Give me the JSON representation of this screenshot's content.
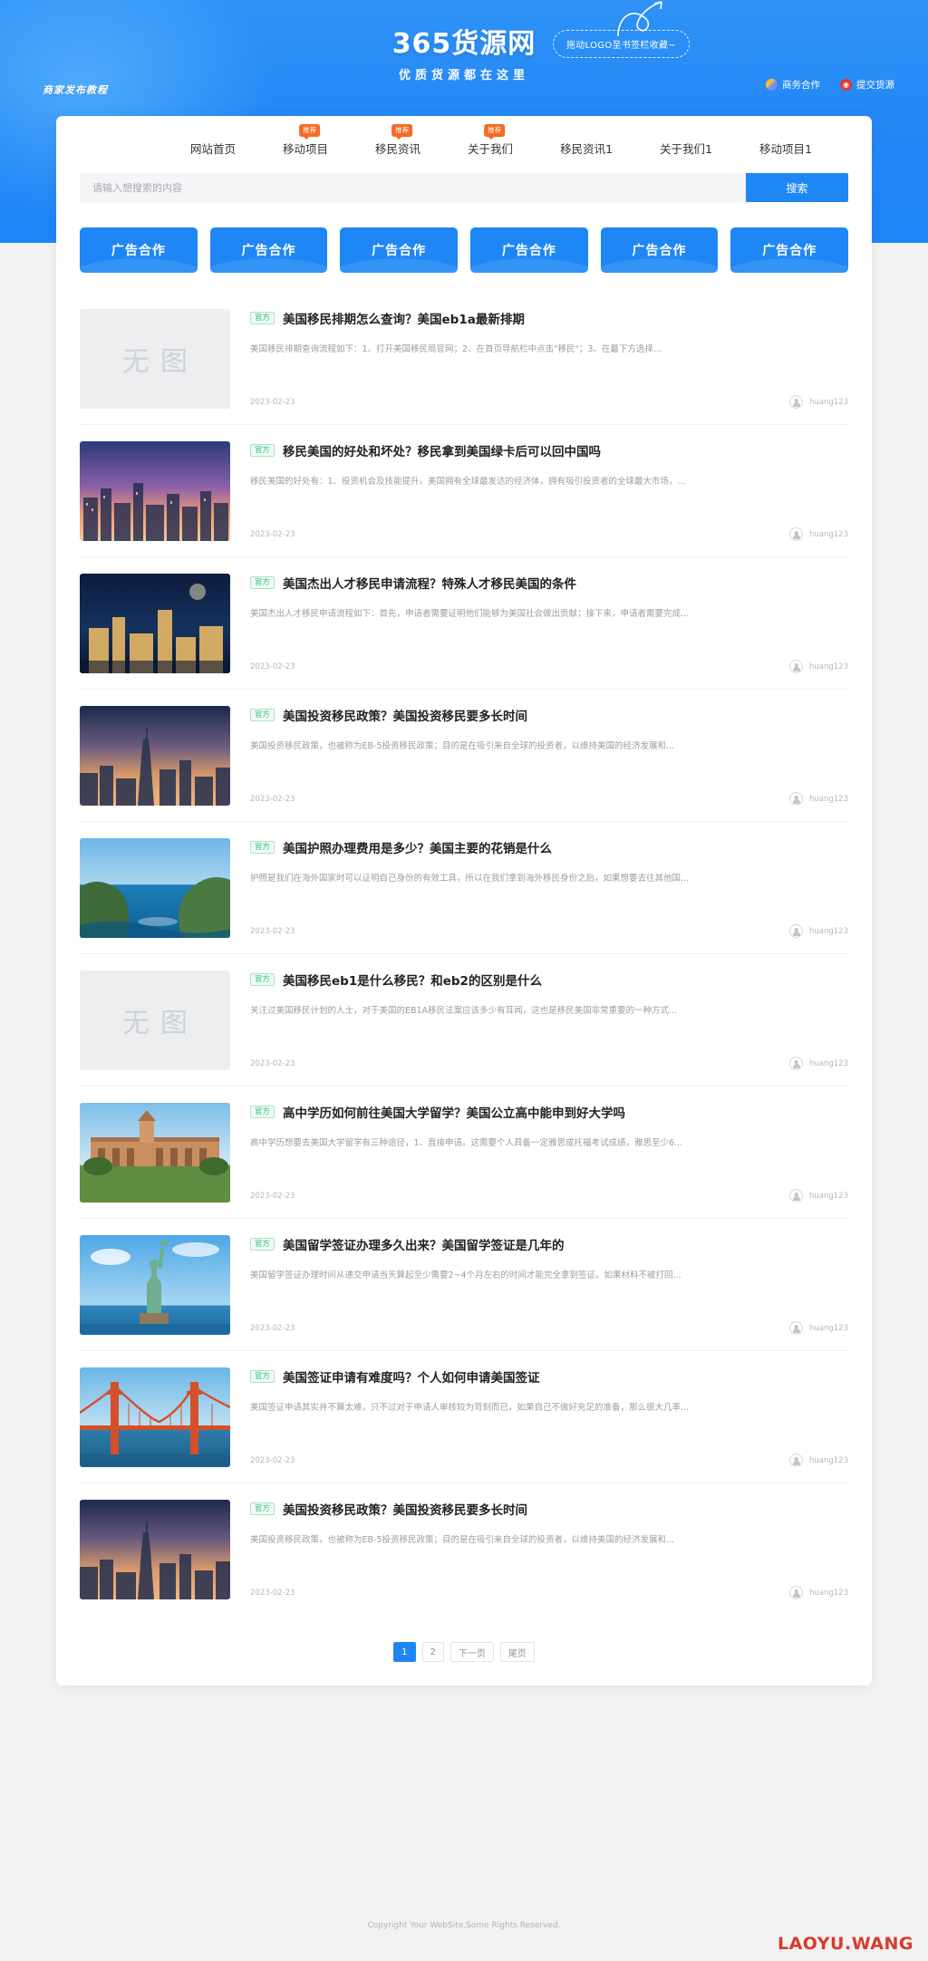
{
  "header": {
    "tutorial_link": "商家发布教程",
    "brand_name": "365货源网",
    "brand_slogan": "优质货源都在这里",
    "drag_tip": "拖动LOGO至书签栏收藏~",
    "links": [
      {
        "label": "商务合作",
        "icon": "handshake-icon"
      },
      {
        "label": "提交货源",
        "icon": "upload-circle-icon"
      }
    ]
  },
  "nav": {
    "items": [
      {
        "label": "网站首页",
        "badge": ""
      },
      {
        "label": "移动项目",
        "badge": "推荐"
      },
      {
        "label": "移民资讯",
        "badge": "推荐"
      },
      {
        "label": "关于我们",
        "badge": "推荐"
      },
      {
        "label": "移民资讯1",
        "badge": ""
      },
      {
        "label": "关于我们1",
        "badge": ""
      },
      {
        "label": "移动项目1",
        "badge": ""
      }
    ]
  },
  "search": {
    "placeholder": "请输入想搜索的内容",
    "value": "",
    "button_label": "搜索"
  },
  "ads": {
    "items": [
      "广告合作",
      "广告合作",
      "广告合作",
      "广告合作",
      "广告合作",
      "广告合作"
    ],
    "color": "#1f87f5"
  },
  "list": {
    "tag_label": "官方",
    "items": [
      {
        "title": "美国移民排期怎么查询？美国eb1a最新排期",
        "excerpt": "美国移民排期查询流程如下：1、打开美国移民局官网；2、在首页导航栏中点击\"移民\"；3、在最下方选择...",
        "date": "2023-02-23",
        "author": "huang123",
        "thumb": "noimage",
        "thumb_text": "无图"
      },
      {
        "title": "移民美国的好处和坏处？移民拿到美国绿卡后可以回中国吗",
        "excerpt": "移民美国的好处有：1、投资机会及技能提升。美国拥有全球最发达的经济体，拥有吸引投资者的全球最大市场，...",
        "date": "2023-02-23",
        "author": "huang123",
        "thumb": "city-sunset",
        "thumb_text": ""
      },
      {
        "title": "美国杰出人才移民申请流程？特殊人才移民美国的条件",
        "excerpt": "美国杰出人才移民申请流程如下：首先，申请者需要证明他们能够为美国社会做出贡献；接下来，申请者需要完成...",
        "date": "2023-02-23",
        "author": "huang123",
        "thumb": "city-night",
        "thumb_text": ""
      },
      {
        "title": "美国投资移民政策？美国投资移民要多长时间",
        "excerpt": "美国投资移民政策，也被称为EB-5投资移民政策；目的是在吸引来自全球的投资者，以维持美国的经济发展和...",
        "date": "2023-02-23",
        "author": "huang123",
        "thumb": "skyline-dusk",
        "thumb_text": ""
      },
      {
        "title": "美国护照办理费用是多少？美国主要的花销是什么",
        "excerpt": "护照是我们在海外国家时可以证明自己身份的有效工具，所以在我们拿到海外移民身份之后，如果想要去往其他国...",
        "date": "2023-02-23",
        "author": "huang123",
        "thumb": "coast-cliff",
        "thumb_text": ""
      },
      {
        "title": "美国移民eb1是什么移民？和eb2的区别是什么",
        "excerpt": "关注过美国移民计划的人士，对于美国的EB1A移民法案应该多少有耳闻，这也是移民美国非常重要的一种方式...",
        "date": "2023-02-23",
        "author": "huang123",
        "thumb": "noimage",
        "thumb_text": "无图"
      },
      {
        "title": "高中学历如何前往美国大学留学？美国公立高中能申到好大学吗",
        "excerpt": "高中学历想要去美国大学留学有三种途径，1、直接申请。这需要个人具备一定雅思或托福考试成绩，雅思至少6...",
        "date": "2023-02-23",
        "author": "huang123",
        "thumb": "campus",
        "thumb_text": ""
      },
      {
        "title": "美国留学签证办理多久出来？美国留学签证是几年的",
        "excerpt": "美国留学签证办理时间从递交申请当天算起至少需要2~4个月左右的时间才能完全拿到签证。如果材料不被打回...",
        "date": "2023-02-23",
        "author": "huang123",
        "thumb": "statue-liberty",
        "thumb_text": ""
      },
      {
        "title": "美国签证申请有难度吗？个人如何申请美国签证",
        "excerpt": "美国签证申请其实并不算太难，只不过对于申请人审核较为苛刻而已，如果自己不做好充足的准备，那么很大几率...",
        "date": "2023-02-23",
        "author": "huang123",
        "thumb": "golden-gate",
        "thumb_text": ""
      },
      {
        "title": "美国投资移民政策？美国投资移民要多长时间",
        "excerpt": "美国投资移民政策，也被称为EB-5投资移民政策；目的是在吸引来自全球的投资者，以维持美国的经济发展和...",
        "date": "2023-02-23",
        "author": "huang123",
        "thumb": "skyline-dusk",
        "thumb_text": ""
      }
    ]
  },
  "pagination": {
    "pages": [
      {
        "label": "1",
        "active": true
      },
      {
        "label": "2",
        "active": false
      },
      {
        "label": "下一页",
        "active": false
      },
      {
        "label": "尾页",
        "active": false
      }
    ]
  },
  "footer": {
    "copyright": "Copyright Your WebSite.Some Rights Reserved.",
    "watermark": "LAOYU.WANG"
  }
}
